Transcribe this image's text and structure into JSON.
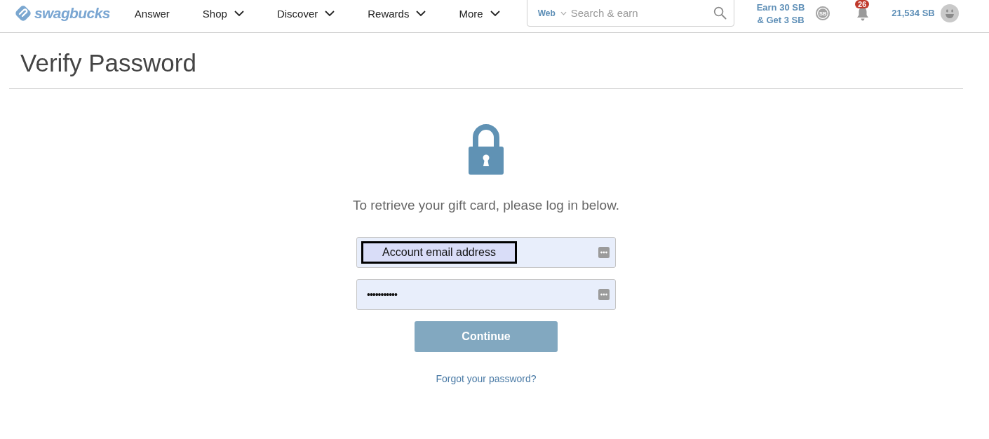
{
  "header": {
    "logo": {
      "text": "swagbucks"
    },
    "nav": [
      {
        "label": "Answer",
        "has_dropdown": false
      },
      {
        "label": "Shop",
        "has_dropdown": true
      },
      {
        "label": "Discover",
        "has_dropdown": true
      },
      {
        "label": "Rewards",
        "has_dropdown": true
      },
      {
        "label": "More",
        "has_dropdown": true
      }
    ],
    "search": {
      "scope": "Web",
      "placeholder": "Search & earn"
    },
    "promo": {
      "lines": [
        "Earn 30 SB",
        "& Get 3 SB"
      ],
      "coin_label": "SB"
    },
    "notifications": {
      "count": "26"
    },
    "balance": "21,534 SB"
  },
  "page": {
    "title": "Verify Password"
  },
  "form": {
    "message": "To retrieve your gift card, please log in below.",
    "email_field": {
      "value": "Account email address"
    },
    "password_field": {
      "value": "•••••••••••"
    },
    "submit": {
      "label": "Continue"
    },
    "forgot_link": "Forgot your password?"
  }
}
